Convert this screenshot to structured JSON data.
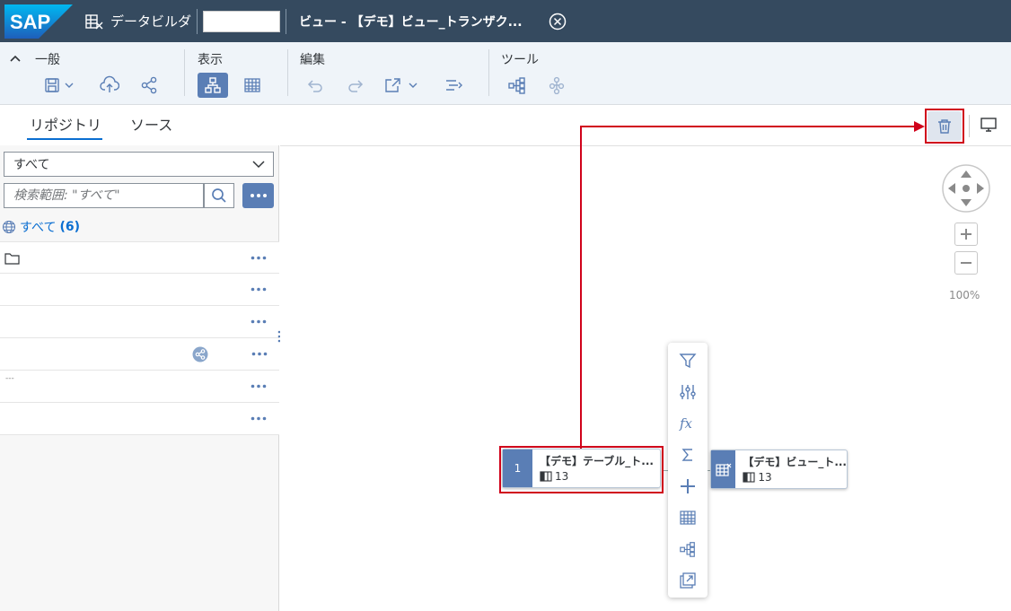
{
  "shell": {
    "logo_text": "SAP",
    "app_name": "データビルダ",
    "view_title": "ビュー - 【デモ】ビュー_トランザク..."
  },
  "toolbar": {
    "groups": {
      "general": "一般",
      "display": "表示",
      "edit": "編集",
      "tools": "ツール"
    }
  },
  "left": {
    "tabs": [
      "リポジトリ",
      "ソース"
    ],
    "filter_value": "すべて",
    "search_placeholder": "検索範囲: \"すべて\"",
    "all_label": "すべて",
    "all_count": "(6)",
    "row_tiny_text": "---"
  },
  "canvas": {
    "zoom_level": "100%",
    "source_node": {
      "index": "1",
      "title": "【デモ】テーブル_ト...",
      "columns": "13"
    },
    "target_node": {
      "title": "【デモ】ビュー_ト...",
      "columns": "13"
    }
  },
  "colors": {
    "shell": "#354a5f",
    "accent": "#5a7eb5",
    "highlight": "#d0021b",
    "link": "#0a6ed1"
  }
}
